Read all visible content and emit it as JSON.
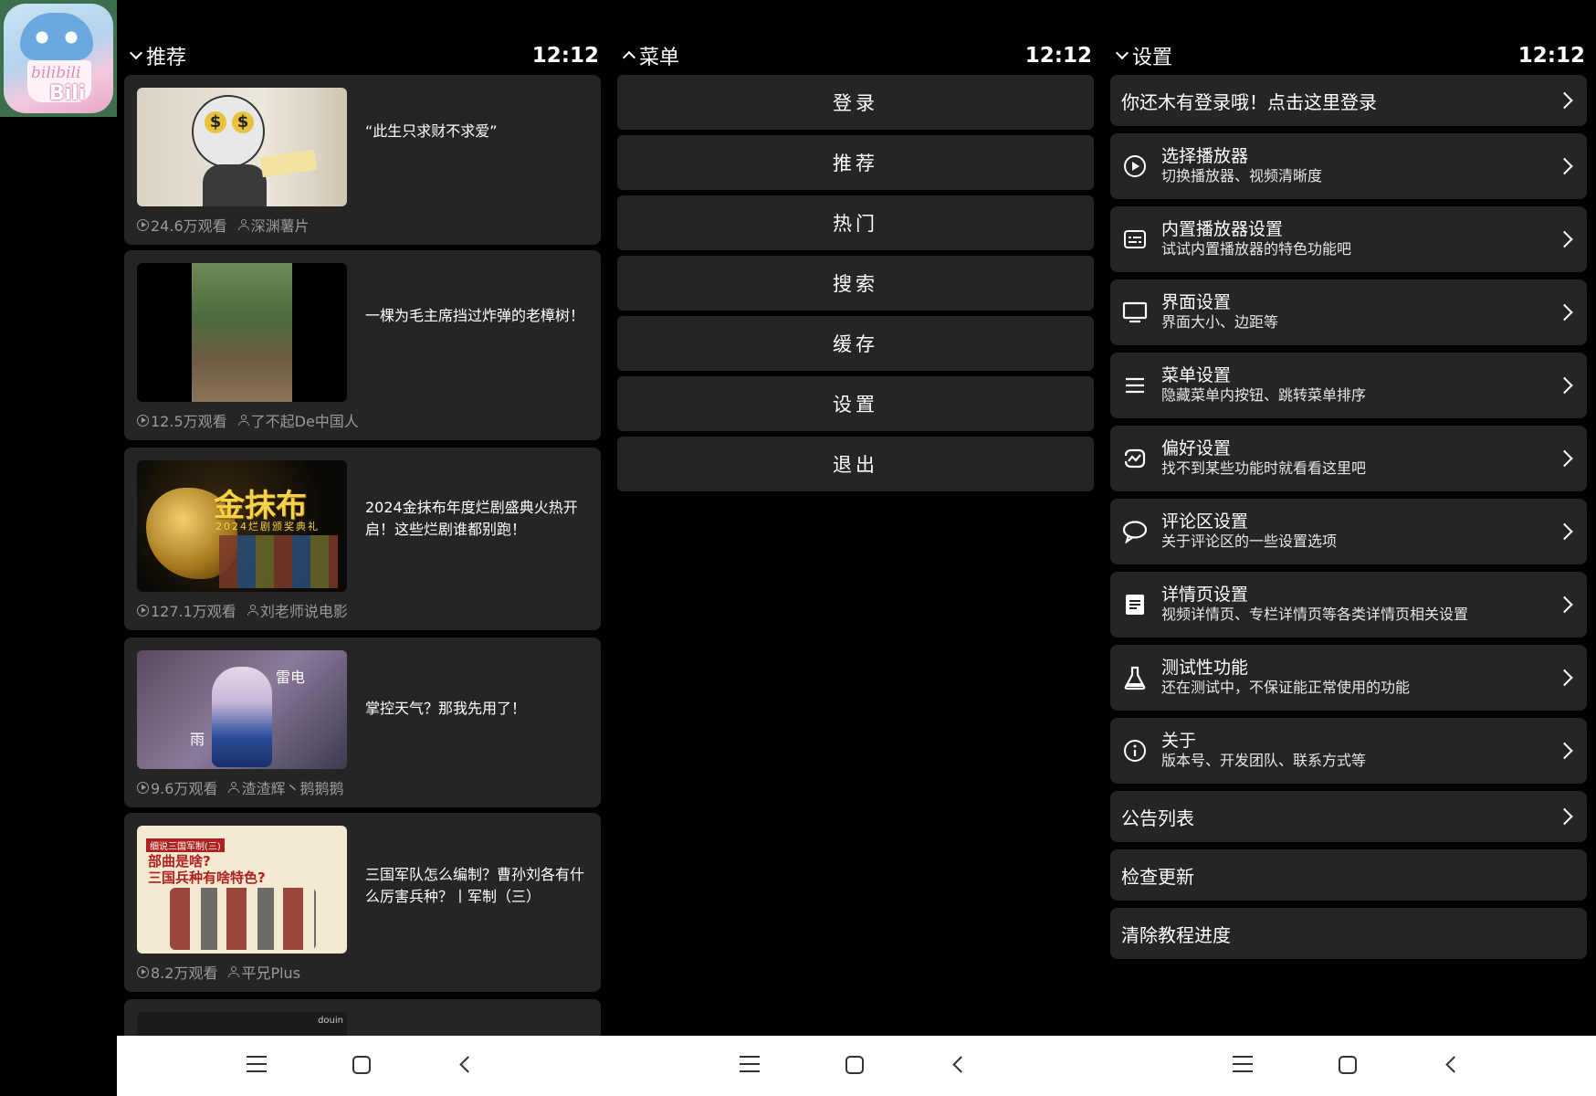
{
  "app_icon": {
    "text_top": "bilibili",
    "text_bottom": "Bili"
  },
  "feed_panel": {
    "title": "推荐",
    "time": "12:12",
    "cards": [
      {
        "title": "“此生只求财不求爱”",
        "views": "24.6万观看",
        "author": "深渊薯片",
        "thumb_text": [
          "$",
          "$"
        ]
      },
      {
        "title": "一棵为毛主席挡过炸弹的老樟树！",
        "views": "12.5万观看",
        "author": "了不起De中国人"
      },
      {
        "title": "2024金抹布年度烂剧盛典火热开启！这些烂剧谁都别跑！",
        "views": "127.1万观看",
        "author": "刘老师说电影",
        "thumb_text": [
          "金抹布",
          "2024烂剧颁奖典礼"
        ]
      },
      {
        "title": "掌控天气？那我先用了！",
        "views": "9.6万观看",
        "author": "渣渣辉丶鹅鹅鹅",
        "thumb_text": [
          "雷电",
          "雨"
        ]
      },
      {
        "title": "三国军队怎么编制？曹孙刘各有什么厉害兵种？丨军制（三）",
        "views": "8.2万观看",
        "author": "平兄Plus",
        "thumb_text": [
          "细说三国军制(三)",
          "部曲是啥?",
          "三国兵种有啥特色?"
        ]
      },
      {
        "thumb_text": [
          "douin"
        ]
      }
    ]
  },
  "menu_panel": {
    "title": "菜单",
    "time": "12:12",
    "items": [
      "登录",
      "推荐",
      "热门",
      "搜索",
      "缓存",
      "设置",
      "退出"
    ]
  },
  "settings_panel": {
    "title": "设置",
    "time": "12:12",
    "login_prompt": "你还木有登录哦！点击这里登录",
    "items": [
      {
        "icon": "play-circle-icon",
        "title": "选择播放器",
        "subtitle": "切换播放器、视频清晰度"
      },
      {
        "icon": "subtitles-icon",
        "title": "内置播放器设置",
        "subtitle": "试试内置播放器的特色功能吧"
      },
      {
        "icon": "monitor-icon",
        "title": "界面设置",
        "subtitle": "界面大小、边距等"
      },
      {
        "icon": "menu-lines-icon",
        "title": "菜单设置",
        "subtitle": "隐藏菜单内按钮、跳转菜单排序"
      },
      {
        "icon": "preference-icon",
        "title": "偏好设置",
        "subtitle": "找不到某些功能时就看看这里吧"
      },
      {
        "icon": "comment-bubble-icon",
        "title": "评论区设置",
        "subtitle": "关于评论区的一些设置选项"
      },
      {
        "icon": "document-icon",
        "title": "详情页设置",
        "subtitle": "视频详情页、专栏详情页等各类详情页相关设置"
      },
      {
        "icon": "flask-icon",
        "title": "测试性功能",
        "subtitle": "还在测试中，不保证能正常使用的功能"
      },
      {
        "icon": "info-icon",
        "title": "关于",
        "subtitle": "版本号、开发团队、联系方式等"
      }
    ],
    "announcements": "公告列表",
    "check_update": "检查更新",
    "clear_tutorial": "清除教程进度"
  }
}
